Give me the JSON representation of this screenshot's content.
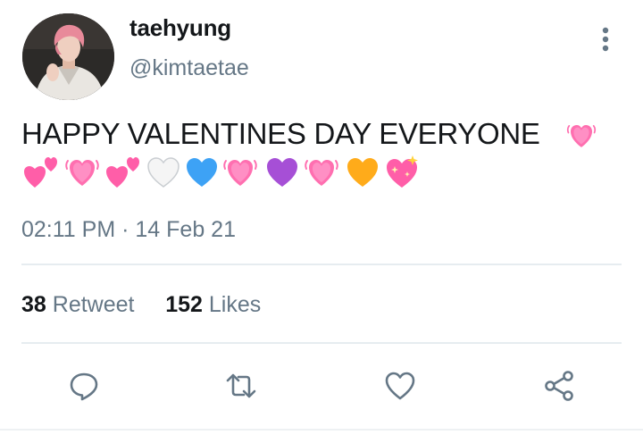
{
  "author": {
    "display_name": "taehyung",
    "handle": "@kimtaetae"
  },
  "tweet": {
    "text": "HAPPY VALENTINES DAY EVERYONE",
    "emojis": [
      "beating-heart",
      "two-hearts",
      "beating-heart",
      "two-hearts",
      "white-heart",
      "blue-heart",
      "beating-heart",
      "purple-heart",
      "beating-heart",
      "orange-heart",
      "sparkling-heart"
    ],
    "time": "02:11 PM",
    "separator": "·",
    "date": "14 Feb 21"
  },
  "stats": {
    "retweets_count": "38",
    "retweets_label": "Retweet",
    "likes_count": "152",
    "likes_label": "Likes"
  },
  "actions": [
    "reply",
    "retweet",
    "like",
    "share"
  ],
  "colors": {
    "text_primary": "#14171a",
    "text_secondary": "#657786",
    "divider": "#e6ecf0",
    "icon": "#657786",
    "pink_heart": "#ff6fb0",
    "blue_heart": "#3da2f5",
    "purple_heart": "#a64fd6",
    "orange_heart": "#ffab1a"
  }
}
